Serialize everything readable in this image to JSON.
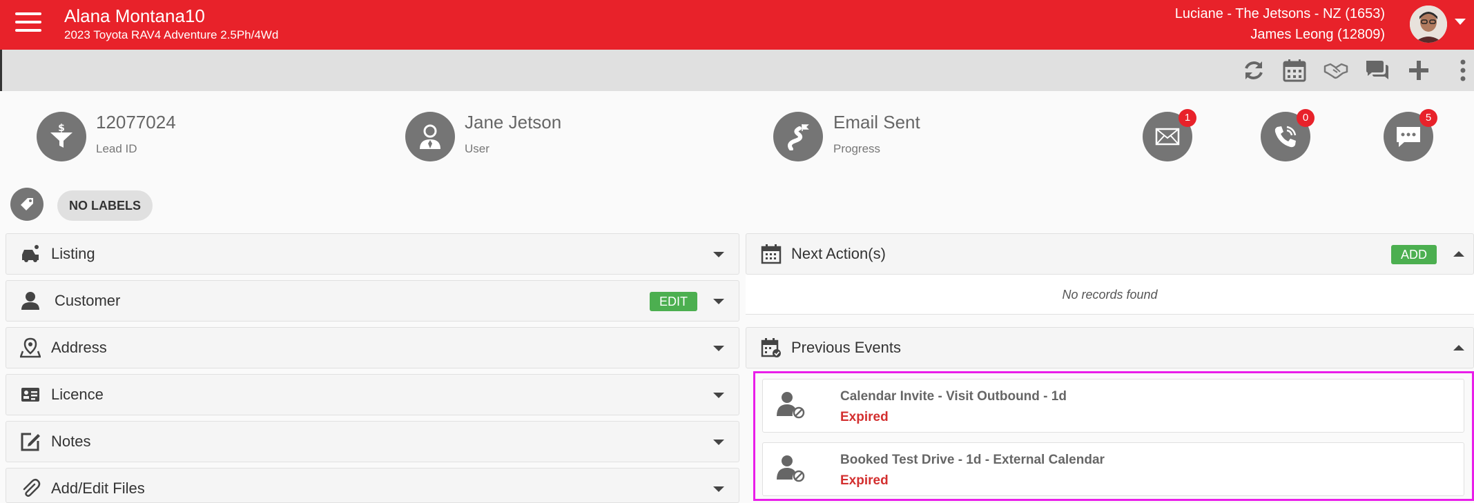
{
  "header": {
    "title": "Alana Montana10",
    "subtitle": "2023 Toyota RAV4 Adventure 2.5Ph/4Wd",
    "dealer": "Luciane - The Jetsons - NZ (1653)",
    "user": "James Leong (12809)"
  },
  "summary": {
    "lead_id": "12077024",
    "lead_id_label": "Lead ID",
    "user": "Jane Jetson",
    "user_label": "User",
    "progress": "Email Sent",
    "progress_label": "Progress",
    "email_count": "1",
    "call_count": "0",
    "message_count": "5"
  },
  "labels": {
    "no_labels": "NO LABELS"
  },
  "panels": {
    "listing": "Listing",
    "customer": "Customer",
    "customer_edit": "EDIT",
    "address": "Address",
    "licence": "Licence",
    "notes": "Notes",
    "files": "Add/Edit Files"
  },
  "next_actions": {
    "title": "Next Action(s)",
    "add": "ADD",
    "empty": "No records found"
  },
  "previous_events": {
    "title": "Previous Events",
    "items": [
      {
        "title": "Calendar Invite - Visit Outbound - 1d",
        "status": "Expired"
      },
      {
        "title": "Booked Test Drive - 1d - External Calendar",
        "status": "Expired"
      }
    ]
  },
  "colors": {
    "brand": "#e8222a",
    "success": "#4caf50",
    "expired": "#d32f2f",
    "highlight": "#e91ee9"
  }
}
